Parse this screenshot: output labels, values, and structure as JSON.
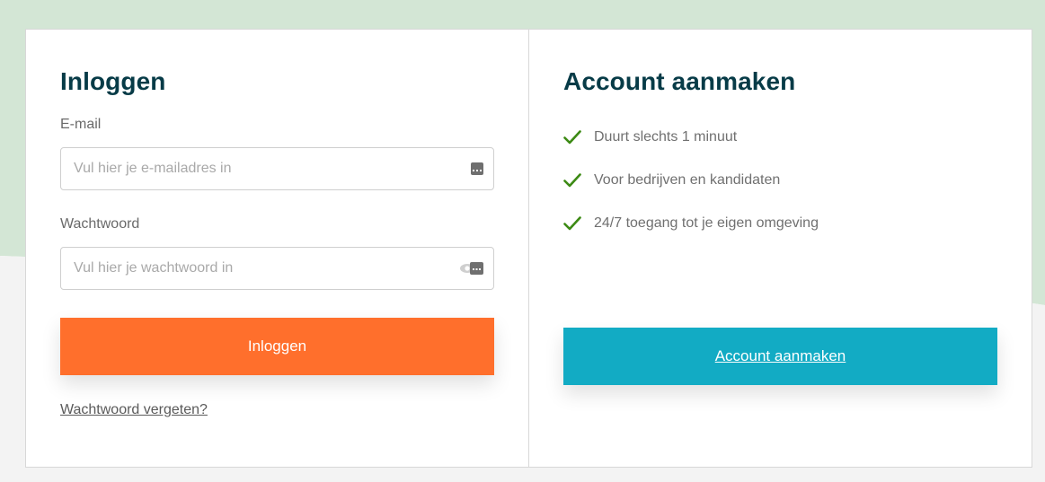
{
  "colors": {
    "heading": "#073b47",
    "login_button": "#ff6f2c",
    "account_button": "#12abc4",
    "check": "#3c8a14",
    "background_band": "#d3e6d5"
  },
  "login": {
    "title": "Inloggen",
    "email_label": "E-mail",
    "email_placeholder": "Vul hier je e-mailadres in",
    "email_value": "",
    "password_label": "Wachtwoord",
    "password_placeholder": "Vul hier je wachtwoord in",
    "password_value": "",
    "submit_label": "Inloggen",
    "forgot_label": "Wachtwoord vergeten?"
  },
  "register": {
    "title": "Account aanmaken",
    "benefits": [
      "Duurt slechts 1 minuut",
      "Voor bedrijven en kandidaten",
      "24/7 toegang tot je eigen omgeving"
    ],
    "button_label": "Account aanmaken"
  },
  "icons": {
    "email_field": "password-manager-icon",
    "password_field": "show-password-icon",
    "benefit": "checkmark-icon"
  }
}
